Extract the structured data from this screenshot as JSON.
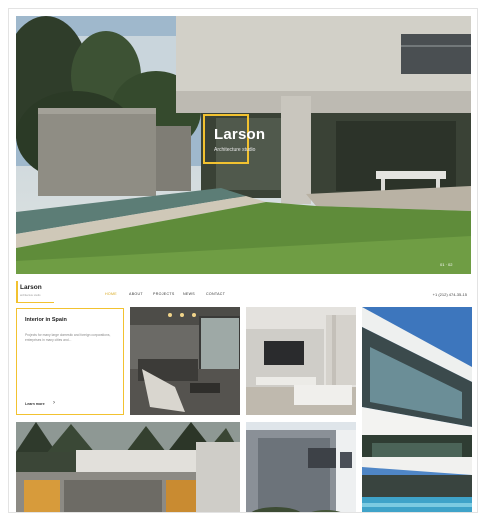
{
  "hero": {
    "title": "Larson",
    "subtitle": "Architecture studio",
    "slide_indicator": "01 · 02"
  },
  "nav": {
    "logo_name": "Larson",
    "logo_sub": "architecture studio",
    "items": [
      {
        "label": "Home",
        "active": true
      },
      {
        "label": "About",
        "active": false
      },
      {
        "label": "Projects",
        "active": false
      },
      {
        "label": "News",
        "active": false
      },
      {
        "label": "Contact",
        "active": false
      }
    ],
    "phone": "+1 (212) 474-35-15"
  },
  "featured": {
    "title": "Interior in Spain",
    "text": "Projects for many large domestic and foreign corporations, enterprises in many cities and...",
    "link": "Learn more"
  },
  "colors": {
    "accent": "#f2c230",
    "active_nav": "#d8a71a"
  }
}
